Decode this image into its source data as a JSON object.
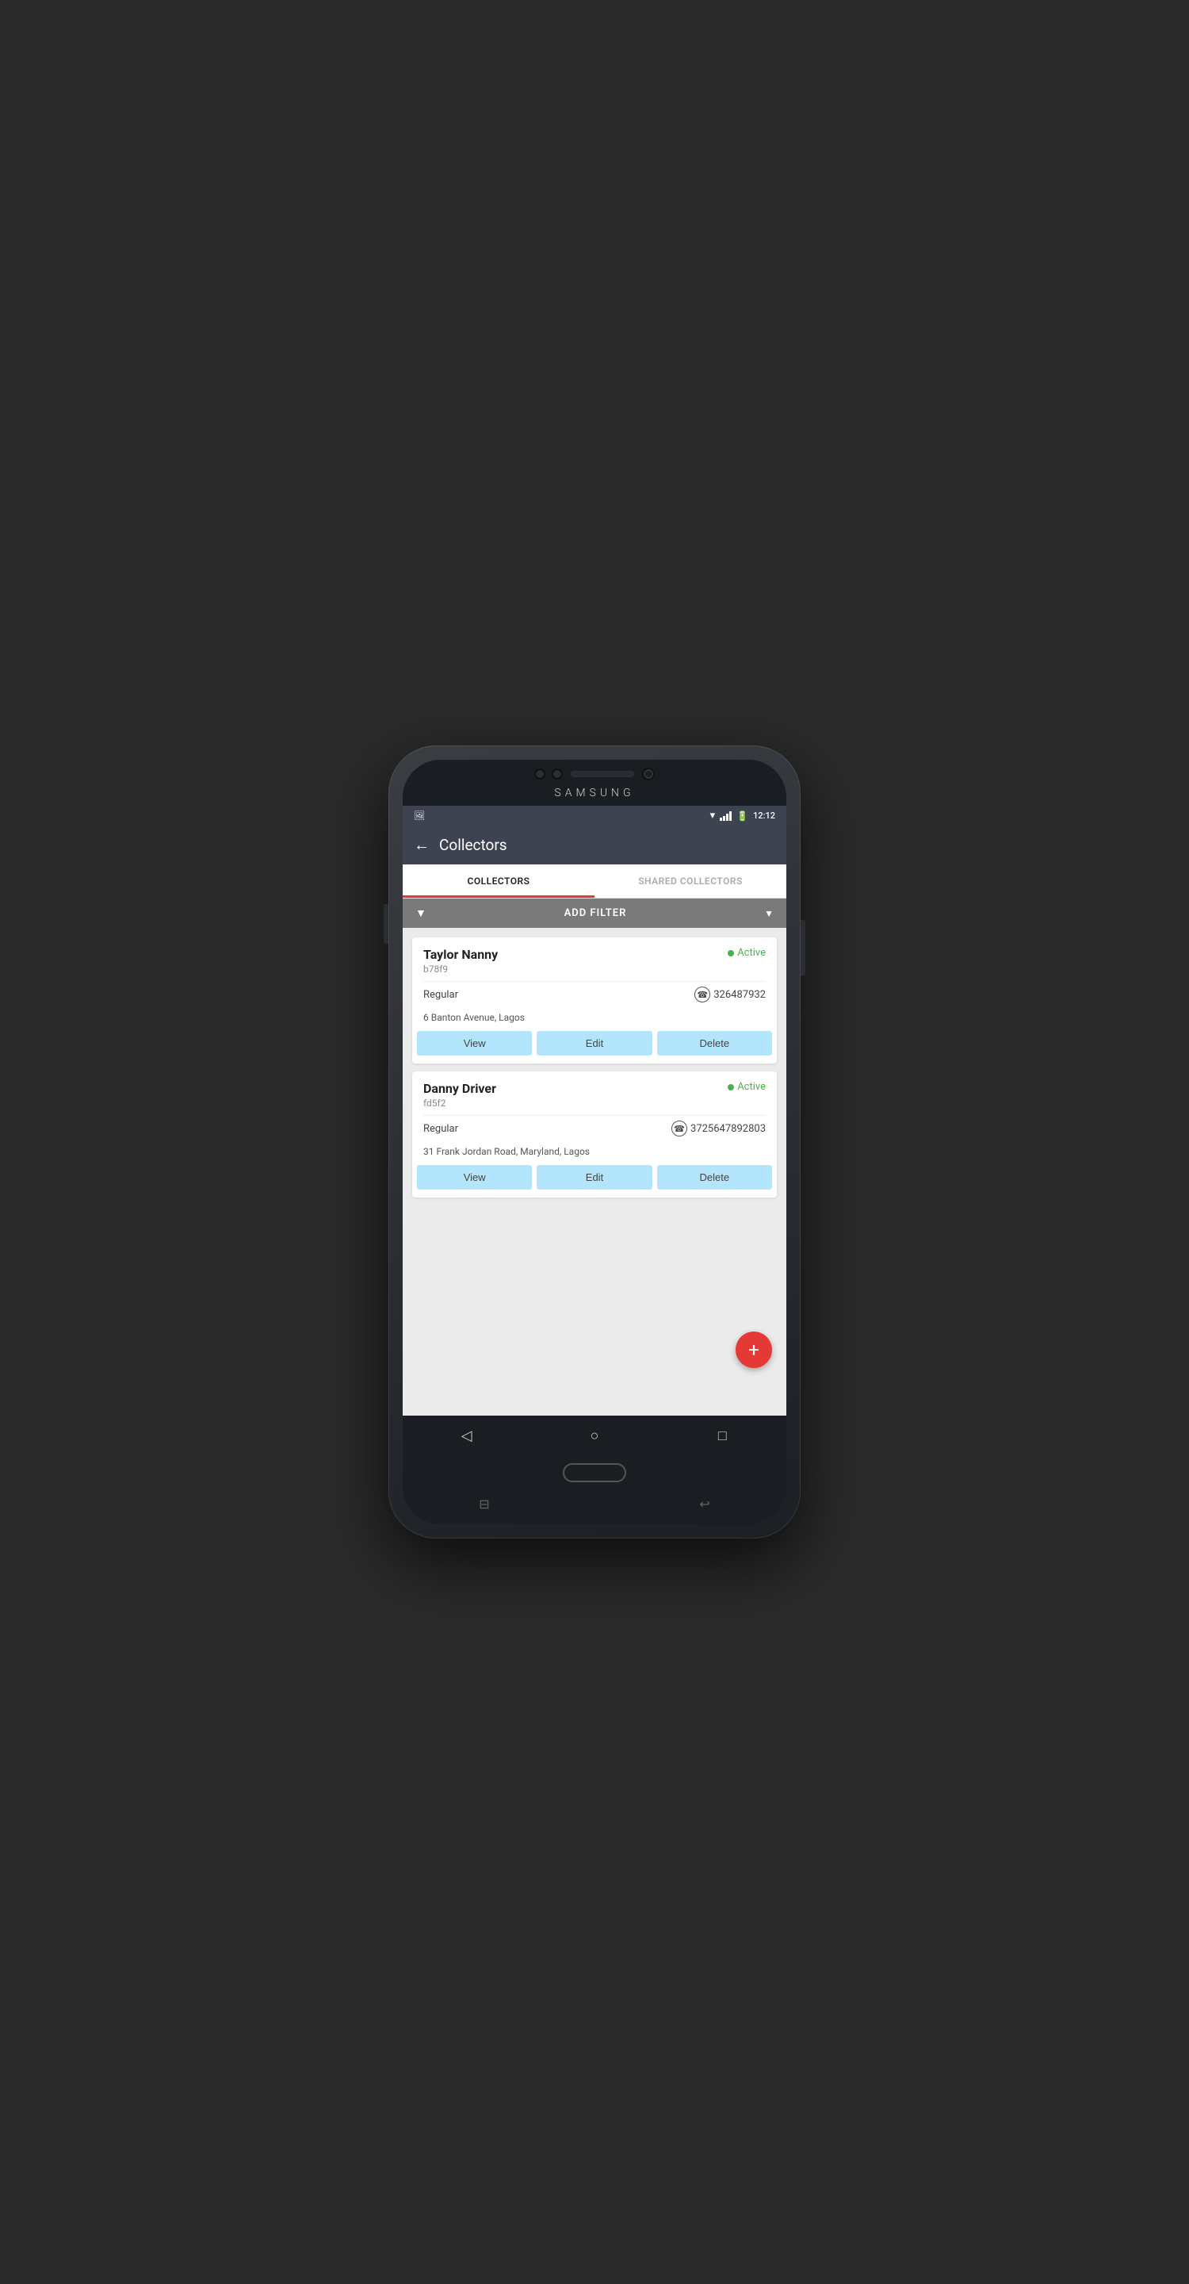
{
  "device": {
    "brand": "SAMSUNG"
  },
  "status_bar": {
    "time": "12:12",
    "battery_icon": "🔋"
  },
  "header": {
    "title": "Collectors",
    "back_label": "←"
  },
  "tabs": [
    {
      "id": "collectors",
      "label": "COLLECTORS",
      "active": true
    },
    {
      "id": "shared",
      "label": "SHARED COLLECTORS",
      "active": false
    }
  ],
  "filter": {
    "icon": "▼",
    "label": "ADD FILTER"
  },
  "collectors": [
    {
      "name": "Taylor  Nanny",
      "id": "b78f9",
      "status": "Active",
      "type": "Regular",
      "phone": "326487932",
      "address": "6 Banton Avenue, Lagos",
      "actions": [
        "View",
        "Edit",
        "Delete"
      ]
    },
    {
      "name": "Danny  Driver",
      "id": "fd5f2",
      "status": "Active",
      "type": "Regular",
      "phone": "3725647892803",
      "address": "31 Frank Jordan Road, Maryland, Lagos",
      "actions": [
        "View",
        "Edit",
        "Delete"
      ]
    }
  ],
  "fab": {
    "label": "+",
    "color": "#e53935"
  },
  "bottom_nav": {
    "back": "◁",
    "home": "○",
    "recents": "□"
  }
}
